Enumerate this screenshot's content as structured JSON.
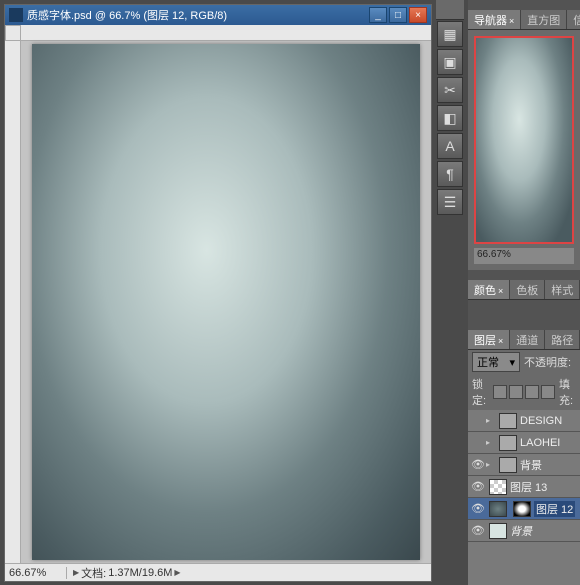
{
  "doc": {
    "title": "质感字体.psd @ 66.7% (图层 12, RGB/8)",
    "zoom": "66.67%",
    "doc_label": "文档:",
    "doc_size": "1.37M/19.6M"
  },
  "tools": [
    "▦",
    "▣",
    "✂",
    "◧",
    "A",
    "¶",
    "☰"
  ],
  "navigator": {
    "tabs": [
      "导航器",
      "直方图",
      "信息"
    ],
    "zoom": "66.67%"
  },
  "color": {
    "tabs": [
      "颜色",
      "色板",
      "样式"
    ]
  },
  "layers": {
    "tabs": [
      "图层",
      "通道",
      "路径"
    ],
    "blend_mode": "正常",
    "opacity_label": "不透明度:",
    "lock_label": "锁定:",
    "fill_label": "填充:",
    "items": [
      {
        "name": "DESIGN",
        "type": "folder",
        "visible": false
      },
      {
        "name": "LAOHEI",
        "type": "folder",
        "visible": false
      },
      {
        "name": "背景",
        "type": "folder",
        "visible": true
      },
      {
        "name": "图层 13",
        "type": "layer",
        "visible": true,
        "thumb": "checker"
      },
      {
        "name": "图层 12",
        "type": "layer",
        "visible": true,
        "selected": true,
        "thumb": "dark",
        "mask": true
      },
      {
        "name": "背景",
        "type": "layer",
        "visible": true,
        "thumb": "light",
        "italic": true
      }
    ]
  }
}
